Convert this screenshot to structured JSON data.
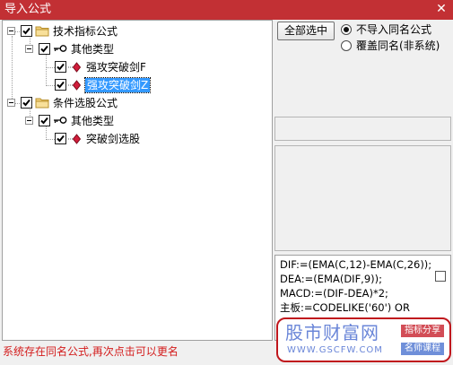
{
  "window": {
    "title": "导入公式",
    "close_glyph": "✕"
  },
  "tree": {
    "root1": {
      "label": "技术指标公式",
      "child": {
        "label": "其他类型",
        "items": [
          "强攻突破剑F",
          "强攻突破剑Z"
        ]
      }
    },
    "root2": {
      "label": "条件选股公式",
      "child": {
        "label": "其他类型",
        "items": [
          "突破剑选股"
        ]
      }
    }
  },
  "actions": {
    "select_all": "全部选中",
    "option_skip": "不导入同名公式",
    "option_overwrite": "覆盖同名(非系统)",
    "selected_option": "option_skip"
  },
  "code": {
    "lines": [
      "DIF:=(EMA(C,12)-EMA(C,26));",
      "DEA:=(EMA(DIF,9));",
      "MACD:=(DIF-DEA)*2;",
      "主板:=CODELIKE('60') OR"
    ]
  },
  "watermark": {
    "name": "股市财富网",
    "url": "WWW.GSCFW.COM",
    "tag1": "指标分享",
    "tag2": "名师课程"
  },
  "status": "系统存在同名公式,再次点击可以更名",
  "colors": {
    "title_bar": "#c23034",
    "selection": "#3399ff",
    "status_text": "#d31c1c",
    "watermark_border": "#c0171d"
  },
  "icons": [
    "close-icon",
    "expander-minus-icon",
    "checkbox-checked-icon",
    "folder-icon",
    "key-icon",
    "formula-diamond-icon",
    "radio-icon"
  ]
}
